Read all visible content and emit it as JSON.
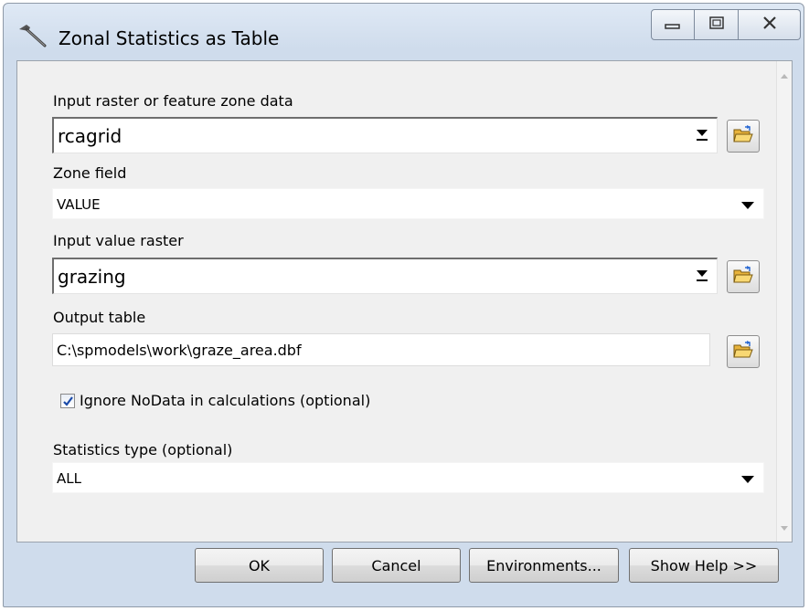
{
  "window": {
    "title": "Zonal Statistics as Table",
    "app_icon": "hammer-tool-icon",
    "caption_buttons": [
      "minimize-icon",
      "maximize-icon",
      "close-icon"
    ]
  },
  "form": {
    "input_raster": {
      "label": "Input raster or feature zone data",
      "value": "rcagrid"
    },
    "zone_field": {
      "label": "Zone field",
      "value": "VALUE"
    },
    "value_raster": {
      "label": "Input value raster",
      "value": "grazing"
    },
    "output_table": {
      "label": "Output table",
      "value": "C:\\spmodels\\work\\graze_area.dbf"
    },
    "ignore_nodata": {
      "label": "Ignore NoData in calculations (optional)",
      "checked": true
    },
    "statistics_type": {
      "label": "Statistics type (optional)",
      "value": "ALL"
    }
  },
  "buttons": {
    "ok": "OK",
    "cancel": "Cancel",
    "environments": "Environments...",
    "show_help": "Show Help >>"
  },
  "colors": {
    "frame": "#cfdcec",
    "client": "#f0f0f0",
    "folder": "#f2c14e"
  }
}
